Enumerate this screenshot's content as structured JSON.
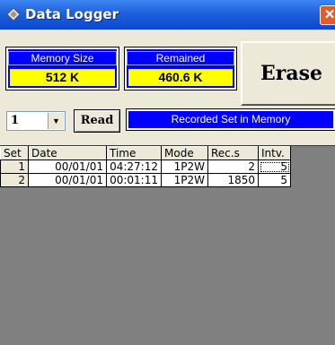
{
  "window": {
    "title": "Data Logger",
    "close_glyph": "✕",
    "app_icon": "diamond-icon"
  },
  "memory_size": {
    "label": "Memory Size",
    "value": "512 K"
  },
  "remained": {
    "label": "Remained",
    "value": "460.6 K"
  },
  "erase_label": "Erase",
  "set_select": {
    "value": "1",
    "arrow": "▼"
  },
  "read_label": "Read",
  "recorded_label": "Recorded Set in Memory",
  "grid": {
    "headers": [
      "Set",
      "Date",
      "Time",
      "Mode",
      "Rec.s",
      "Intv."
    ],
    "rows": [
      [
        "1",
        "00/01/01",
        "04:27:12",
        "1P2W",
        "2",
        "5"
      ],
      [
        "2",
        "00/01/01",
        "00:01:11",
        "1P2W",
        "1850",
        "5"
      ]
    ]
  },
  "colors": {
    "panel_blue": "#0000ff",
    "value_yellow": "#ffff00",
    "title_blue": "#1f5fdc",
    "close_red": "#e35a2f"
  }
}
